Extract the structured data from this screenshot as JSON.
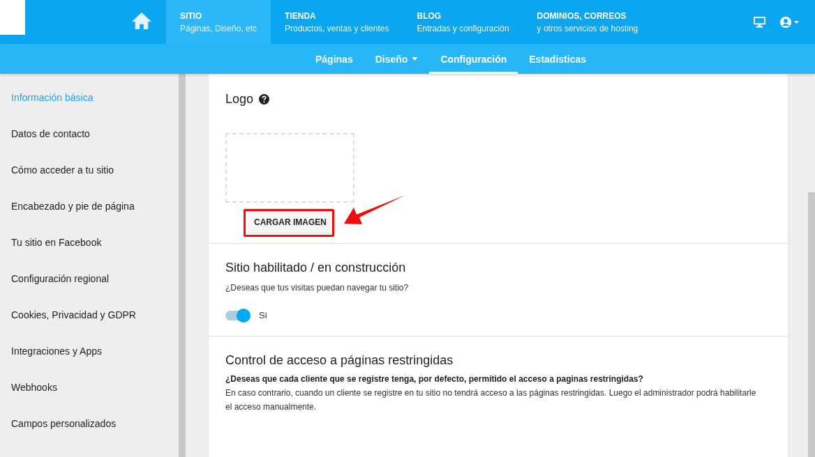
{
  "main_nav": [
    {
      "title": "SITIO",
      "subtitle": "Páginas, Diseño, etc",
      "selected": true
    },
    {
      "title": "TIENDA",
      "subtitle": "Productos, ventas y clientes",
      "selected": false
    },
    {
      "title": "BLOG",
      "subtitle": "Entradas y configuración",
      "selected": false
    },
    {
      "title": "DOMINIOS, CORREOS",
      "subtitle": "y otros servicios de hosting",
      "selected": false
    }
  ],
  "sub_nav": [
    {
      "label": "Páginas",
      "selected": false,
      "has_menu": false
    },
    {
      "label": "Diseño",
      "selected": false,
      "has_menu": true
    },
    {
      "label": "Configuración",
      "selected": true,
      "has_menu": false
    },
    {
      "label": "Estadisticas",
      "selected": false,
      "has_menu": false
    }
  ],
  "sidebar": {
    "items": [
      {
        "label": "Información básica",
        "selected": true
      },
      {
        "label": "Datos de contacto",
        "selected": false
      },
      {
        "label": "Cómo acceder a tu sitio",
        "selected": false
      },
      {
        "label": "Encabezado y pie de página",
        "selected": false
      },
      {
        "label": "Tu sitio en Facebook",
        "selected": false
      },
      {
        "label": "Configuración regional",
        "selected": false
      },
      {
        "label": "Cookies, Privacidad y GDPR",
        "selected": false
      },
      {
        "label": "Integraciones y Apps",
        "selected": false
      },
      {
        "label": "Webhooks",
        "selected": false
      },
      {
        "label": "Campos personalizados",
        "selected": false
      }
    ]
  },
  "logo_section": {
    "title": "Logo",
    "button": "CARGAR IMAGEN"
  },
  "site_section": {
    "title": "Sitio habilitado / en construcción",
    "question": "¿Deseas que tus visitas puedan navegar tu sitio?",
    "toggle": {
      "on": true,
      "label": "Si"
    }
  },
  "access_section": {
    "title": "Control de acceso a páginas restringidas",
    "question": "¿Deseas que cada cliente que se registre tenga, por defecto, permitido el acceso a paginas restringidas?",
    "description": "En caso contrario, cuando un cliente se registre en tu sitio no tendrá acceso a las páginas restringidas. Luego el administrador podrá habilitarle el acceso manualmente."
  }
}
